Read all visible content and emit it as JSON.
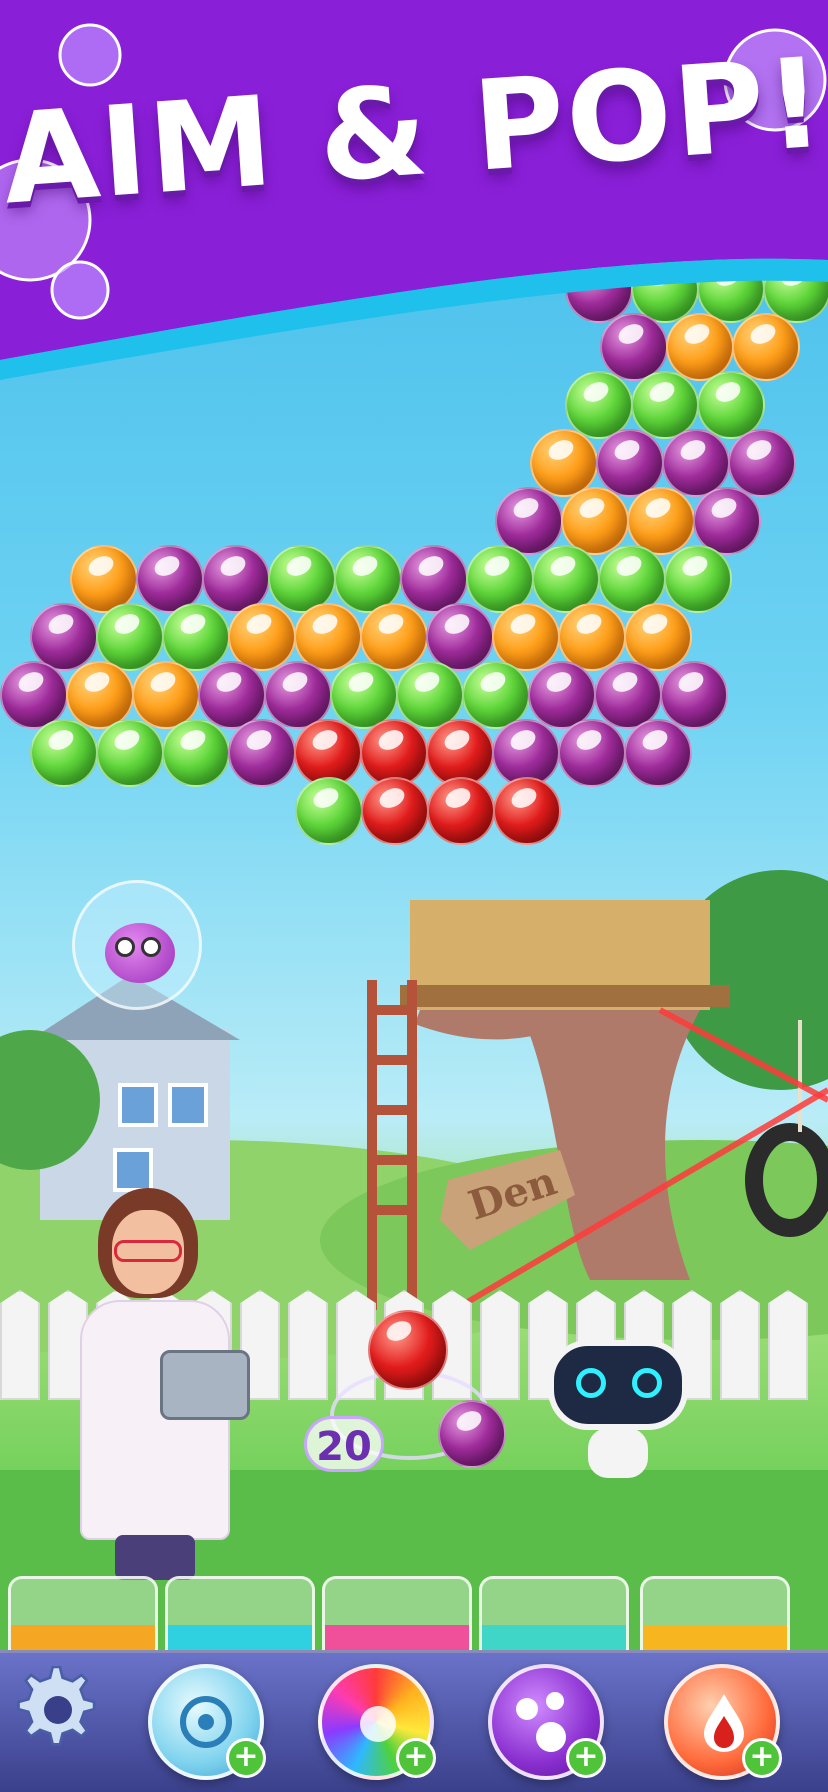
{
  "banner": {
    "title": "AIM & POP!",
    "background_color": "#8a1fd8",
    "accent_color": "#1fc0ec"
  },
  "scene": {
    "sign_text": "Den"
  },
  "shooter": {
    "shots_remaining": "20",
    "current_bubble": "red",
    "next_bubble": "purple"
  },
  "characters": {
    "scientist": "scientist-girl",
    "robot": "robot-companion",
    "trapped_creature": "purple-creature-in-bubble"
  },
  "bubble_grid": {
    "colors": {
      "orange": "#ff9f1a",
      "green": "#5fd63a",
      "purple": "#a02c9c",
      "red": "#e21c1c"
    },
    "rows": [
      [
        "purple",
        "green",
        "green",
        "green"
      ],
      [
        "purple",
        "orange",
        "orange"
      ],
      [
        "green",
        "green",
        "green"
      ],
      [
        "orange",
        "purple",
        "purple",
        "purple"
      ],
      [
        "purple",
        "orange",
        "orange",
        "purple"
      ],
      [
        "orange",
        "purple",
        "purple",
        "green",
        "green",
        "purple",
        "green",
        "green",
        "green",
        "green"
      ],
      [
        "purple",
        "green",
        "green",
        "orange",
        "orange",
        "orange",
        "purple",
        "orange",
        "orange",
        "orange"
      ],
      [
        "purple",
        "orange",
        "orange",
        "purple",
        "purple",
        "green",
        "green",
        "green",
        "purple",
        "purple",
        "purple"
      ],
      [
        "green",
        "green",
        "green",
        "purple",
        "red",
        "red",
        "red",
        "purple",
        "purple",
        "purple"
      ],
      [
        "green",
        "red",
        "red",
        "red"
      ]
    ]
  },
  "jars": [
    {
      "name": "orange-jar",
      "liquid_color": "#f5a623"
    },
    {
      "name": "cyan-jar",
      "liquid_color": "#2fd0e0"
    },
    {
      "name": "pink-jar",
      "liquid_color": "#f0509a"
    },
    {
      "name": "aqua-jar",
      "liquid_color": "#3fd6c8"
    },
    {
      "name": "yellow-jar",
      "liquid_color": "#f7b51f"
    }
  ],
  "toolbar": {
    "settings_icon": "gear-icon",
    "boosters": [
      {
        "name": "target-booster",
        "icon": "target-bubble-icon"
      },
      {
        "name": "rainbow-booster",
        "icon": "rainbow-swirl-icon"
      },
      {
        "name": "multi-bubble-booster",
        "icon": "bubbles-cluster-icon"
      },
      {
        "name": "fire-booster",
        "icon": "fire-drop-icon"
      }
    ],
    "plus_label": "+"
  }
}
